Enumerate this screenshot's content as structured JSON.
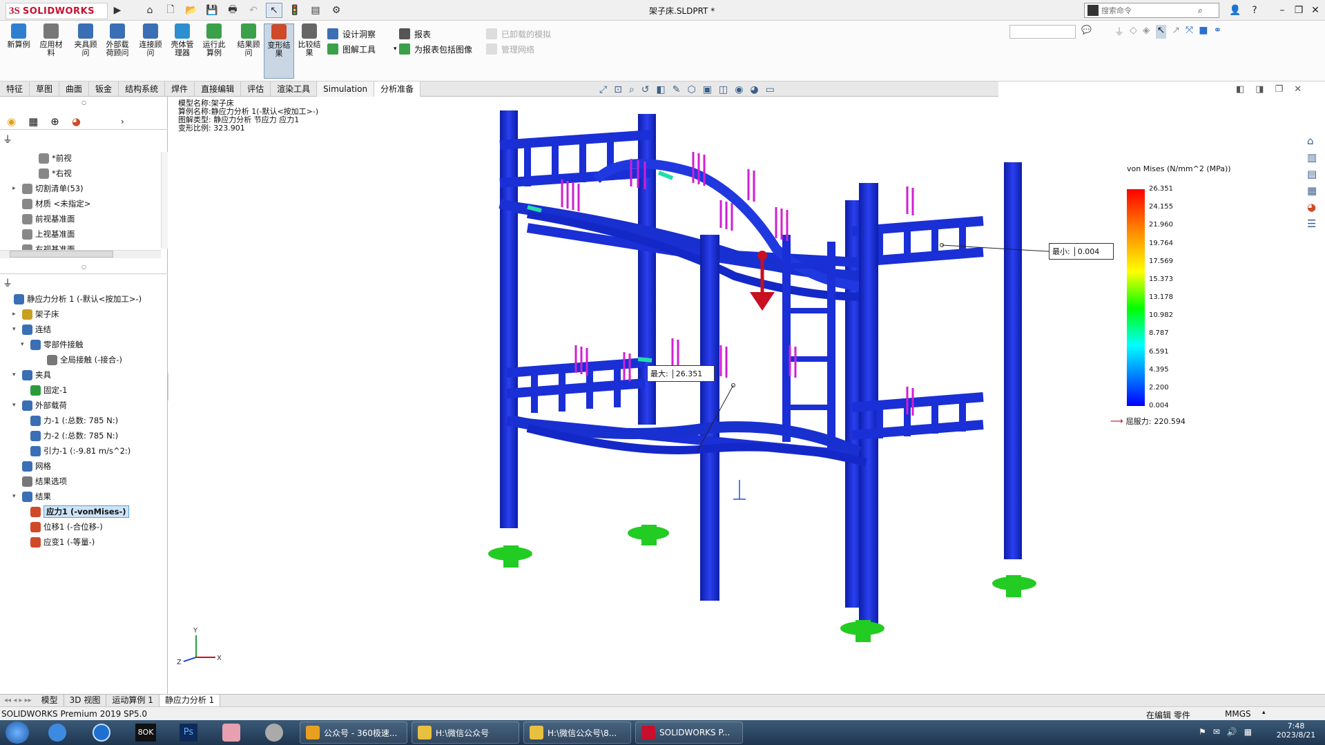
{
  "titlebar": {
    "brand": "SOLIDWORKS",
    "brand_mark": "3S",
    "doc_title": "架子床.SLDPRT *",
    "search_placeholder": "搜索命令"
  },
  "cmd": {
    "big": [
      {
        "label": "新算例",
        "color": "#2f7fd0"
      },
      {
        "label": "应用材料",
        "color": "#777"
      },
      {
        "label": "夹具顾问",
        "color": "#3a6fb5"
      },
      {
        "label": "外部载荷顾问",
        "color": "#3a6fb5"
      },
      {
        "label": "连接顾问",
        "color": "#3a6fb5"
      },
      {
        "label": "壳体管理器",
        "color": "#2d8fd0"
      },
      {
        "label": "运行此算例",
        "color": "#3aa04a"
      },
      {
        "label": "结果顾问",
        "color": "#3aa04a"
      },
      {
        "label": "变形结果",
        "color": "#d04a2a"
      },
      {
        "label": "比较结果",
        "color": "#666"
      }
    ],
    "small_col1": [
      "设计洞察",
      "图解工具"
    ],
    "small_col2": [
      "报表",
      "为报表包括图像"
    ],
    "small_col3": [
      "已卸载的模拟",
      "管理网络"
    ]
  },
  "tabs": [
    "特征",
    "草图",
    "曲面",
    "钣金",
    "结构系统",
    "焊件",
    "直接编辑",
    "评估",
    "渲染工具",
    "Simulation",
    "分析准备"
  ],
  "tabs_active": "分析准备",
  "tree_top": [
    {
      "label": "*前视",
      "indent": 3,
      "expand": ""
    },
    {
      "label": "*右视",
      "indent": 3,
      "expand": ""
    },
    {
      "label": "切割清单(53)",
      "indent": 1,
      "expand": "▸"
    },
    {
      "label": "材质 <未指定>",
      "indent": 1,
      "expand": ""
    },
    {
      "label": "前视基准面",
      "indent": 1,
      "expand": ""
    },
    {
      "label": "上视基准面",
      "indent": 1,
      "expand": ""
    },
    {
      "label": "右视基准面",
      "indent": 1,
      "expand": ""
    }
  ],
  "tree_sim": [
    {
      "label": "静应力分析 1 (-默认<按加工>-)",
      "indent": 0,
      "expand": "",
      "icon": "#3a6fb5"
    },
    {
      "label": "架子床",
      "indent": 1,
      "expand": "▸",
      "icon": "#c8a020"
    },
    {
      "label": "连结",
      "indent": 1,
      "expand": "▾",
      "icon": "#3a6fb5"
    },
    {
      "label": "零部件接触",
      "indent": 2,
      "expand": "▾",
      "icon": "#3a6fb5"
    },
    {
      "label": "全局接触 (-接合-)",
      "indent": 4,
      "expand": "",
      "icon": "#777"
    },
    {
      "label": "夹具",
      "indent": 1,
      "expand": "▾",
      "icon": "#3a6fb5"
    },
    {
      "label": "固定-1",
      "indent": 2,
      "expand": "",
      "icon": "#2a9c3a"
    },
    {
      "label": "外部载荷",
      "indent": 1,
      "expand": "▾",
      "icon": "#3a6fb5"
    },
    {
      "label": "力-1 (:总数: 785 N:)",
      "indent": 2,
      "expand": "",
      "icon": "#3a6fb5"
    },
    {
      "label": "力-2 (:总数: 785 N:)",
      "indent": 2,
      "expand": "",
      "icon": "#3a6fb5"
    },
    {
      "label": "引力-1 (:-9.81 m/s^2:)",
      "indent": 2,
      "expand": "",
      "icon": "#3a6fb5"
    },
    {
      "label": "网格",
      "indent": 1,
      "expand": "",
      "icon": "#3a6fb5"
    },
    {
      "label": "结果选项",
      "indent": 1,
      "expand": "",
      "icon": "#777"
    },
    {
      "label": "结果",
      "indent": 1,
      "expand": "▾",
      "icon": "#3a6fb5"
    },
    {
      "label": "应力1 (-vonMises-)",
      "indent": 2,
      "expand": "",
      "icon": "#d04a2a"
    },
    {
      "label": "位移1 (-合位移-)",
      "indent": 2,
      "expand": "",
      "icon": "#d04a2a"
    },
    {
      "label": "应变1 (-等量-)",
      "indent": 2,
      "expand": "",
      "icon": "#d04a2a"
    }
  ],
  "tree_sim_selected": 14,
  "viewport": {
    "info": [
      "模型名称:架子床",
      "算例名称:静应力分析 1(-默认<按加工>-)",
      "图解类型: 静应力分析 节应力 应力1",
      "变形比例: 323.901"
    ],
    "min_label": "最小:",
    "min_value": "0.004",
    "max_label": "最大:",
    "max_value": "26.351"
  },
  "legend": {
    "title": "von Mises (N/mm^2 (MPa))",
    "ticks": [
      "26.351",
      "24.155",
      "21.960",
      "19.764",
      "17.569",
      "15.373",
      "13.178",
      "10.982",
      "8.787",
      "6.591",
      "4.395",
      "2.200",
      "0.004"
    ],
    "yield_label": "屈服力:",
    "yield_value": "220.594"
  },
  "bottom_tabs": [
    "模型",
    "3D 视图",
    "运动算例 1",
    "静应力分析 1"
  ],
  "bottom_tab_active": "静应力分析 1",
  "status": {
    "version": "SOLIDWORKS Premium 2019 SP5.0",
    "mode": "在编辑 零件",
    "units": "MMGS"
  },
  "taskbar": {
    "items": [
      {
        "label": "公众号 - 360极速...",
        "color": "#e8a020"
      },
      {
        "label": "H:\\微信公众号",
        "color": "#e8c040"
      },
      {
        "label": "H:\\微信公众号\\8...",
        "color": "#e8c040"
      },
      {
        "label": "SOLIDWORKS P...",
        "color": "#c8102e"
      }
    ],
    "time": "7:48",
    "date": "2023/8/21"
  },
  "colors": {
    "accent": "#c8102e",
    "model_blue": "#1a2fd6",
    "load_magenta": "#d21fd2",
    "fixture_green": "#22cc22"
  }
}
